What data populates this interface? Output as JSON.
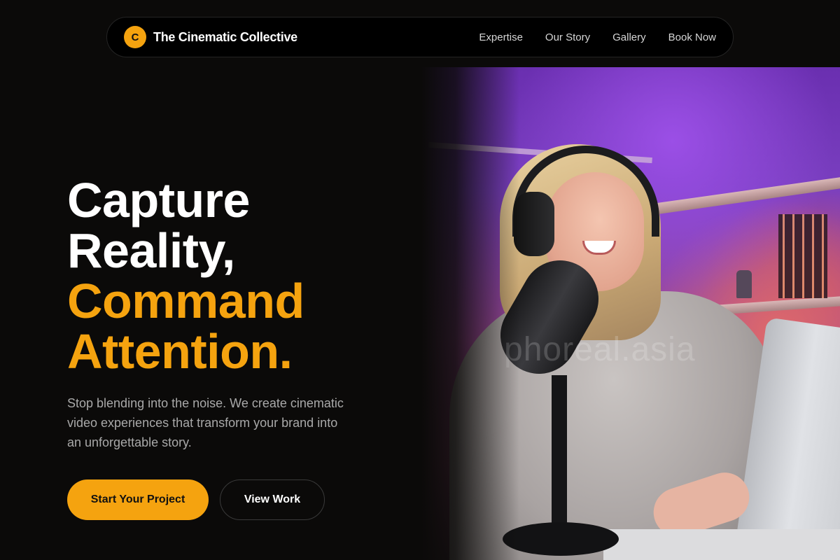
{
  "nav": {
    "brand_initial": "C",
    "brand_name": "The Cinematic Collective",
    "links": [
      "Expertise",
      "Our Story",
      "Gallery",
      "Book Now"
    ]
  },
  "hero": {
    "headline_line1": "Capture",
    "headline_line2": "Reality,",
    "headline_line3": "Command",
    "headline_line4": "Attention.",
    "subtext": "Stop blending into the noise. We create cinematic video experiences that transform your brand into an unforgettable story.",
    "primary_cta": "Start Your Project",
    "secondary_cta": "View Work",
    "photo_watermark": "phoreal.asia"
  },
  "colors": {
    "background": "#0b0a09",
    "accent": "#f5a30f",
    "text_primary": "#ffffff",
    "text_muted": "#a9a9a9"
  }
}
